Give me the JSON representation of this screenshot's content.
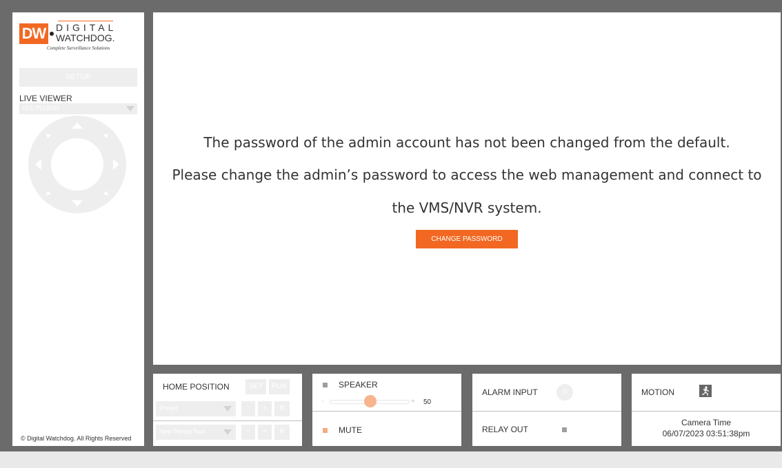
{
  "logo": {
    "mark": "DW",
    "line1": "DIGITAL",
    "line2": "WATCHDOG.",
    "tagline": "Complete Surveillance Solutions"
  },
  "sidebar": {
    "setup_label": "SETUP",
    "live_viewer_label": "LIVE VIEWER",
    "plugin_value": "VLC PLUGIN",
    "footer": "© Digital Watchdog. All Rights Reserved"
  },
  "main": {
    "line1": "The password of the admin account has not been changed from the default.",
    "line2": "Please change the admin’s password to access the web management and connect to",
    "line3": "the VMS/NVR system.",
    "change_password_label": "CHANGE PASSWORD"
  },
  "ptz_panel": {
    "home_position_label": "HOME POSITION",
    "set_label": "SET",
    "run_label": "RUN",
    "preset_value": "Preset",
    "tour_value": "New Preset Tour",
    "minus_label": "-",
    "plus_label": "+",
    "r_label": "R"
  },
  "audio_panel": {
    "speaker_label": "SPEAKER",
    "slider_min_label": "-",
    "slider_plus_label": "+",
    "slider_value": "50",
    "mute_label": "MUTE"
  },
  "alarm_panel": {
    "alarm_input_label": "ALARM INPUT",
    "alarm_input_value": "0",
    "relay_out_label": "RELAY OUT"
  },
  "motion_panel": {
    "motion_label": "MOTION",
    "camera_time_label": "Camera Time",
    "camera_time_value": "06/07/2023 03:51:38pm"
  },
  "colors": {
    "accent": "#f26822",
    "frame": "#6b6b6b",
    "disabled": "#eeeeee"
  }
}
